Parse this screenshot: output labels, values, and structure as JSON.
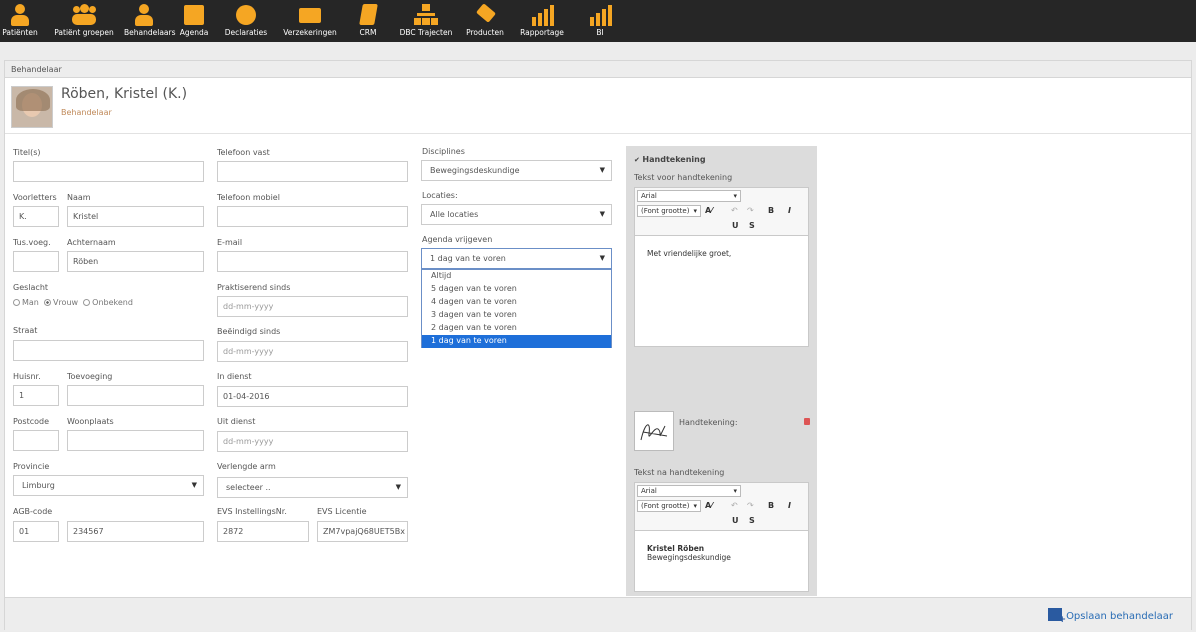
{
  "nav": [
    {
      "label": "Patiënten",
      "icon": "patient-icon"
    },
    {
      "label": "Patiënt groepen",
      "icon": "patient-groups-icon"
    },
    {
      "label": "Behandelaars",
      "icon": "therapists-icon"
    },
    {
      "label": "Agenda",
      "icon": "calendar-icon"
    },
    {
      "label": "Declaraties",
      "icon": "euro-icon"
    },
    {
      "label": "Verzekeringen",
      "icon": "inbox-icon"
    },
    {
      "label": "CRM",
      "icon": "notebook-icon"
    },
    {
      "label": "DBC Trajecten",
      "icon": "hierarchy-icon"
    },
    {
      "label": "Producten",
      "icon": "tag-icon"
    },
    {
      "label": "Rapportage",
      "icon": "bar-chart-icon"
    },
    {
      "label": "BI",
      "icon": "bar-chart-icon"
    }
  ],
  "panel_title": "Behandelaar",
  "profile": {
    "name": "Röben, Kristel (K.)",
    "role": "Behandelaar"
  },
  "fields": {
    "titels": {
      "label": "Titel(s)",
      "value": ""
    },
    "voorletters": {
      "label": "Voorletters",
      "value": "K."
    },
    "naam": {
      "label": "Naam",
      "value": "Kristel"
    },
    "tusvoeg": {
      "label": "Tus.voeg.",
      "value": ""
    },
    "achternaam": {
      "label": "Achternaam",
      "value": "Röben"
    },
    "geslacht": {
      "label": "Geslacht",
      "options": [
        "Man",
        "Vrouw",
        "Onbekend"
      ],
      "selected": "Vrouw"
    },
    "straat": {
      "label": "Straat",
      "value": ""
    },
    "huisnr": {
      "label": "Huisnr.",
      "value": "1"
    },
    "toevoeging": {
      "label": "Toevoeging",
      "value": ""
    },
    "postcode": {
      "label": "Postcode",
      "value": ""
    },
    "woonplaats": {
      "label": "Woonplaats",
      "value": ""
    },
    "provincie": {
      "label": "Provincie",
      "value": "Limburg"
    },
    "agb": {
      "label": "AGB-code",
      "value1": "01",
      "value2": "234567"
    },
    "telvast": {
      "label": "Telefoon vast",
      "value": ""
    },
    "telmobiel": {
      "label": "Telefoon mobiel",
      "value": ""
    },
    "email": {
      "label": "E-mail",
      "value": ""
    },
    "praktiserend": {
      "label": "Praktiserend sinds",
      "placeholder": "dd-mm-yyyy"
    },
    "beeindigd": {
      "label": "Beëindigd sinds",
      "placeholder": "dd-mm-yyyy"
    },
    "indienst": {
      "label": "In dienst",
      "value": "01-04-2016"
    },
    "uitdienst": {
      "label": "Uit dienst",
      "placeholder": "dd-mm-yyyy"
    },
    "verlengde": {
      "label": "Verlengde arm",
      "value": "selecteer .."
    },
    "evs_nr": {
      "label": "EVS InstellingsNr.",
      "value": "2872"
    },
    "evs_lic": {
      "label": "EVS Licentie",
      "value": "ZM7vpajQ68UET5Bx"
    },
    "disciplines": {
      "label": "Disciplines",
      "value": "Bewegingsdeskundige"
    },
    "locaties": {
      "label": "Locaties:",
      "value": "Alle locaties"
    },
    "agenda": {
      "label": "Agenda vrijgeven",
      "value": "1 dag van te voren",
      "options": [
        "Altijd",
        "5 dagen van te voren",
        "4 dagen van te voren",
        "3 dagen van te voren",
        "2 dagen van te voren",
        "1 dag van te voren"
      ]
    }
  },
  "signature": {
    "checkbox_label": "Handtekening",
    "before_label": "Tekst voor handtekening",
    "font": "Arial",
    "size": "(Font grootte)",
    "before_text": "Met vriendelijke groet,",
    "sig_label": "Handtekening:",
    "after_label": "Tekst na handtekening",
    "after_name": "Kristel Röben",
    "after_role": "Bewegingsdeskundige"
  },
  "save_label": "Opslaan behandelaar",
  "colors": {
    "nav_bg": "#262626",
    "accent": "#f5a623",
    "selected": "#1e6fd9"
  }
}
